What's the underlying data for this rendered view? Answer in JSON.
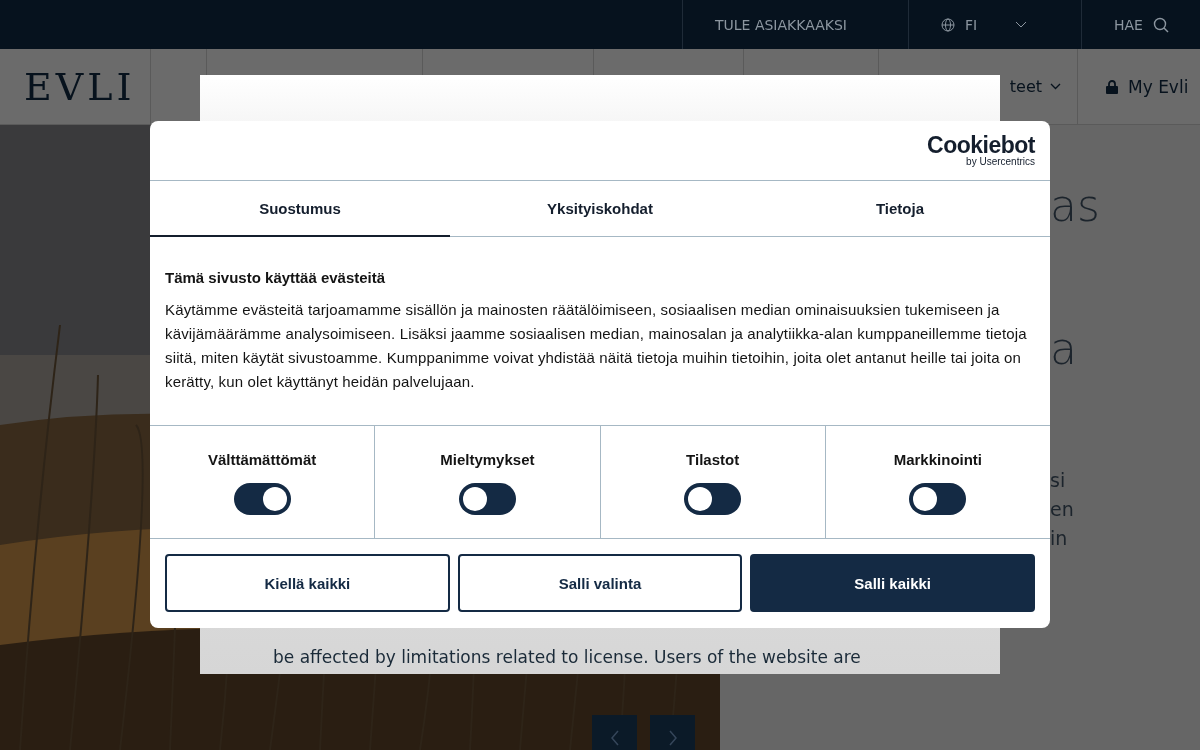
{
  "top_bar": {
    "links": [
      {
        "label": "TULE ASIAKKAAKSI",
        "kind": "link"
      },
      {
        "label": "FI",
        "kind": "language"
      },
      {
        "label": "HAE",
        "kind": "search"
      }
    ]
  },
  "nav": {
    "logo": "EVLI",
    "items": [
      {
        "label": "teet"
      }
    ],
    "account": "My Evli"
  },
  "hero": {
    "fragments": [
      {
        "text": "as",
        "kind": "title"
      },
      {
        "text": "a",
        "kind": "title"
      },
      {
        "text": "si",
        "kind": "body"
      },
      {
        "text": "en",
        "kind": "body"
      },
      {
        "text": "in",
        "kind": "body"
      }
    ]
  },
  "notice": {
    "lines": [
      "be affected by limitations related to license. Users of the website are"
    ]
  },
  "cookie_dialog": {
    "brand": "Cookiebot",
    "brand_sub": "by Usercentrics",
    "tabs": [
      {
        "label": "Suostumus",
        "selected": true
      },
      {
        "label": "Yksityiskohdat",
        "selected": false
      },
      {
        "label": "Tietoja",
        "selected": false
      }
    ],
    "heading": "Tämä sivusto käyttää evästeitä",
    "text": "Käytämme evästeitä tarjoamamme sisällön ja mainosten räätälöimiseen, sosiaalisen median ominaisuuksien tukemiseen ja kävijämäärämme analysoimiseen. Lisäksi jaamme sosiaalisen median, mainosalan ja analytiikka-alan kumppaneillemme tietoja siitä, miten käytät sivustoamme. Kumppanimme voivat yhdistää näitä tietoja muihin tietoihin, joita olet antanut heille tai joita on kerätty, kun olet käyttänyt heidän palvelujaan.",
    "categories": [
      {
        "label": "Välttämättömät",
        "on": true
      },
      {
        "label": "Mieltymykset",
        "on": false
      },
      {
        "label": "Tilastot",
        "on": false
      },
      {
        "label": "Markkinointi",
        "on": false
      }
    ],
    "buttons": [
      {
        "label": "Kiellä kaikki",
        "kind": "outline"
      },
      {
        "label": "Salli valinta",
        "kind": "outline"
      },
      {
        "label": "Salli kaikki",
        "kind": "filled"
      }
    ]
  }
}
